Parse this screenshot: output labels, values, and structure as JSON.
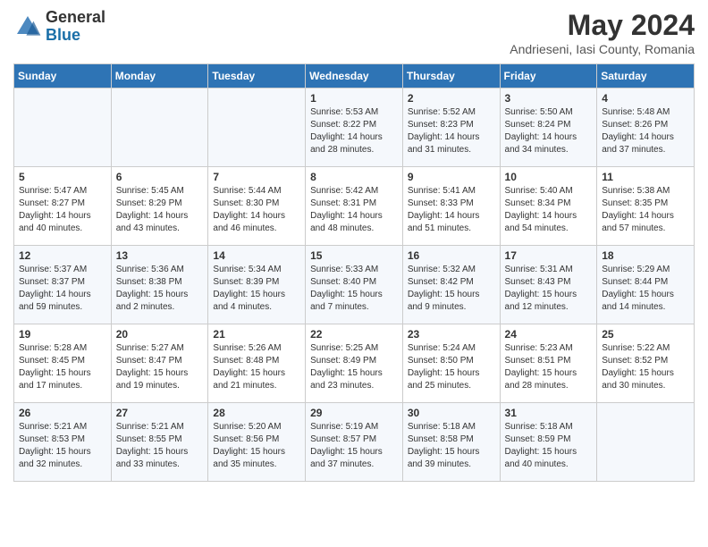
{
  "logo": {
    "general": "General",
    "blue": "Blue"
  },
  "title": "May 2024",
  "location": "Andrieseni, Iasi County, Romania",
  "days_header": [
    "Sunday",
    "Monday",
    "Tuesday",
    "Wednesday",
    "Thursday",
    "Friday",
    "Saturday"
  ],
  "weeks": [
    [
      {
        "day": "",
        "info": ""
      },
      {
        "day": "",
        "info": ""
      },
      {
        "day": "",
        "info": ""
      },
      {
        "day": "1",
        "info": "Sunrise: 5:53 AM\nSunset: 8:22 PM\nDaylight: 14 hours\nand 28 minutes."
      },
      {
        "day": "2",
        "info": "Sunrise: 5:52 AM\nSunset: 8:23 PM\nDaylight: 14 hours\nand 31 minutes."
      },
      {
        "day": "3",
        "info": "Sunrise: 5:50 AM\nSunset: 8:24 PM\nDaylight: 14 hours\nand 34 minutes."
      },
      {
        "day": "4",
        "info": "Sunrise: 5:48 AM\nSunset: 8:26 PM\nDaylight: 14 hours\nand 37 minutes."
      }
    ],
    [
      {
        "day": "5",
        "info": "Sunrise: 5:47 AM\nSunset: 8:27 PM\nDaylight: 14 hours\nand 40 minutes."
      },
      {
        "day": "6",
        "info": "Sunrise: 5:45 AM\nSunset: 8:29 PM\nDaylight: 14 hours\nand 43 minutes."
      },
      {
        "day": "7",
        "info": "Sunrise: 5:44 AM\nSunset: 8:30 PM\nDaylight: 14 hours\nand 46 minutes."
      },
      {
        "day": "8",
        "info": "Sunrise: 5:42 AM\nSunset: 8:31 PM\nDaylight: 14 hours\nand 48 minutes."
      },
      {
        "day": "9",
        "info": "Sunrise: 5:41 AM\nSunset: 8:33 PM\nDaylight: 14 hours\nand 51 minutes."
      },
      {
        "day": "10",
        "info": "Sunrise: 5:40 AM\nSunset: 8:34 PM\nDaylight: 14 hours\nand 54 minutes."
      },
      {
        "day": "11",
        "info": "Sunrise: 5:38 AM\nSunset: 8:35 PM\nDaylight: 14 hours\nand 57 minutes."
      }
    ],
    [
      {
        "day": "12",
        "info": "Sunrise: 5:37 AM\nSunset: 8:37 PM\nDaylight: 14 hours\nand 59 minutes."
      },
      {
        "day": "13",
        "info": "Sunrise: 5:36 AM\nSunset: 8:38 PM\nDaylight: 15 hours\nand 2 minutes."
      },
      {
        "day": "14",
        "info": "Sunrise: 5:34 AM\nSunset: 8:39 PM\nDaylight: 15 hours\nand 4 minutes."
      },
      {
        "day": "15",
        "info": "Sunrise: 5:33 AM\nSunset: 8:40 PM\nDaylight: 15 hours\nand 7 minutes."
      },
      {
        "day": "16",
        "info": "Sunrise: 5:32 AM\nSunset: 8:42 PM\nDaylight: 15 hours\nand 9 minutes."
      },
      {
        "day": "17",
        "info": "Sunrise: 5:31 AM\nSunset: 8:43 PM\nDaylight: 15 hours\nand 12 minutes."
      },
      {
        "day": "18",
        "info": "Sunrise: 5:29 AM\nSunset: 8:44 PM\nDaylight: 15 hours\nand 14 minutes."
      }
    ],
    [
      {
        "day": "19",
        "info": "Sunrise: 5:28 AM\nSunset: 8:45 PM\nDaylight: 15 hours\nand 17 minutes."
      },
      {
        "day": "20",
        "info": "Sunrise: 5:27 AM\nSunset: 8:47 PM\nDaylight: 15 hours\nand 19 minutes."
      },
      {
        "day": "21",
        "info": "Sunrise: 5:26 AM\nSunset: 8:48 PM\nDaylight: 15 hours\nand 21 minutes."
      },
      {
        "day": "22",
        "info": "Sunrise: 5:25 AM\nSunset: 8:49 PM\nDaylight: 15 hours\nand 23 minutes."
      },
      {
        "day": "23",
        "info": "Sunrise: 5:24 AM\nSunset: 8:50 PM\nDaylight: 15 hours\nand 25 minutes."
      },
      {
        "day": "24",
        "info": "Sunrise: 5:23 AM\nSunset: 8:51 PM\nDaylight: 15 hours\nand 28 minutes."
      },
      {
        "day": "25",
        "info": "Sunrise: 5:22 AM\nSunset: 8:52 PM\nDaylight: 15 hours\nand 30 minutes."
      }
    ],
    [
      {
        "day": "26",
        "info": "Sunrise: 5:21 AM\nSunset: 8:53 PM\nDaylight: 15 hours\nand 32 minutes."
      },
      {
        "day": "27",
        "info": "Sunrise: 5:21 AM\nSunset: 8:55 PM\nDaylight: 15 hours\nand 33 minutes."
      },
      {
        "day": "28",
        "info": "Sunrise: 5:20 AM\nSunset: 8:56 PM\nDaylight: 15 hours\nand 35 minutes."
      },
      {
        "day": "29",
        "info": "Sunrise: 5:19 AM\nSunset: 8:57 PM\nDaylight: 15 hours\nand 37 minutes."
      },
      {
        "day": "30",
        "info": "Sunrise: 5:18 AM\nSunset: 8:58 PM\nDaylight: 15 hours\nand 39 minutes."
      },
      {
        "day": "31",
        "info": "Sunrise: 5:18 AM\nSunset: 8:59 PM\nDaylight: 15 hours\nand 40 minutes."
      },
      {
        "day": "",
        "info": ""
      }
    ]
  ]
}
